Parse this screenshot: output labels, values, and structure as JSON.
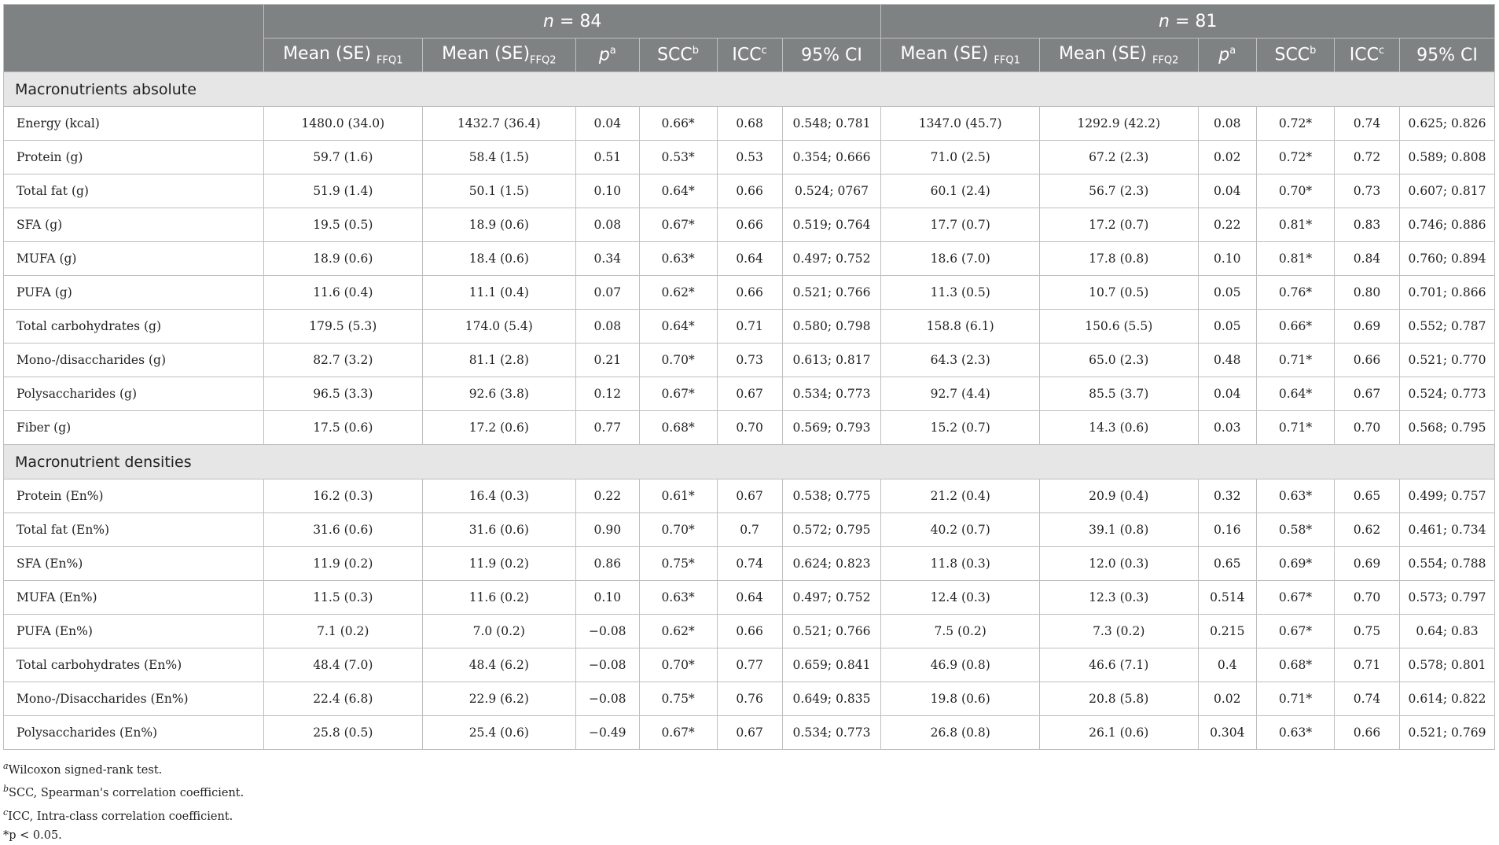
{
  "header": {
    "group1_label_n": "n",
    "group1_label_eq": " = 84",
    "group2_label_n": "n",
    "group2_label_eq": " = 81",
    "columns": [
      {
        "main": "Mean (SE) ",
        "sub": "FFQ1",
        "kind": "sub"
      },
      {
        "main": "Mean (SE)",
        "sub": "FFQ2",
        "kind": "sub"
      },
      {
        "main": "p",
        "sup": "a",
        "kind": "sup-italic"
      },
      {
        "main": "SCC",
        "sup": "b",
        "kind": "sup"
      },
      {
        "main": "ICC",
        "sup": "c",
        "kind": "sup"
      },
      {
        "main": "95% CI",
        "kind": "plain"
      },
      {
        "main": "Mean (SE) ",
        "sub": "FFQ1",
        "kind": "sub"
      },
      {
        "main": "Mean (SE) ",
        "sub": "FFQ2",
        "kind": "sub"
      },
      {
        "main": "p",
        "sup": "a",
        "kind": "sup-italic"
      },
      {
        "main": "SCC",
        "sup": "b",
        "kind": "sup"
      },
      {
        "main": "ICC",
        "sup": "c",
        "kind": "sup"
      },
      {
        "main": "95% CI",
        "kind": "plain"
      }
    ]
  },
  "sections": [
    {
      "title": "Macronutrients absolute",
      "rows": [
        {
          "label": "Energy (kcal)",
          "cells": [
            "1480.0 (34.0)",
            "1432.7 (36.4)",
            "0.04",
            "0.66*",
            "0.68",
            "0.548; 0.781",
            "1347.0 (45.7)",
            "1292.9 (42.2)",
            "0.08",
            "0.72*",
            "0.74",
            "0.625; 0.826"
          ]
        },
        {
          "label": "Protein (g)",
          "cells": [
            "59.7 (1.6)",
            "58.4 (1.5)",
            "0.51",
            "0.53*",
            "0.53",
            "0.354; 0.666",
            "71.0 (2.5)",
            "67.2 (2.3)",
            "0.02",
            "0.72*",
            "0.72",
            "0.589; 0.808"
          ]
        },
        {
          "label": "Total fat (g)",
          "cells": [
            "51.9 (1.4)",
            "50.1 (1.5)",
            "0.10",
            "0.64*",
            "0.66",
            "0.524; 0767",
            "60.1 (2.4)",
            "56.7 (2.3)",
            "0.04",
            "0.70*",
            "0.73",
            "0.607; 0.817"
          ]
        },
        {
          "label": "SFA (g)",
          "cells": [
            "19.5 (0.5)",
            "18.9 (0.6)",
            "0.08",
            "0.67*",
            "0.66",
            "0.519; 0.764",
            "17.7 (0.7)",
            "17.2 (0.7)",
            "0.22",
            "0.81*",
            "0.83",
            "0.746; 0.886"
          ]
        },
        {
          "label": "MUFA (g)",
          "cells": [
            "18.9 (0.6)",
            "18.4 (0.6)",
            "0.34",
            "0.63*",
            "0.64",
            "0.497; 0.752",
            "18.6 (7.0)",
            "17.8 (0.8)",
            "0.10",
            "0.81*",
            "0.84",
            "0.760; 0.894"
          ]
        },
        {
          "label": "PUFA (g)",
          "cells": [
            "11.6 (0.4)",
            "11.1 (0.4)",
            "0.07",
            "0.62*",
            "0.66",
            "0.521; 0.766",
            "11.3 (0.5)",
            "10.7 (0.5)",
            "0.05",
            "0.76*",
            "0.80",
            "0.701; 0.866"
          ]
        },
        {
          "label": "Total carbohydrates (g)",
          "cells": [
            "179.5 (5.3)",
            "174.0 (5.4)",
            "0.08",
            "0.64*",
            "0.71",
            "0.580; 0.798",
            "158.8 (6.1)",
            "150.6 (5.5)",
            "0.05",
            "0.66*",
            "0.69",
            "0.552; 0.787"
          ]
        },
        {
          "label": "Mono-/disaccharides (g)",
          "cells": [
            "82.7 (3.2)",
            "81.1 (2.8)",
            "0.21",
            "0.70*",
            "0.73",
            "0.613; 0.817",
            "64.3 (2.3)",
            "65.0 (2.3)",
            "0.48",
            "0.71*",
            "0.66",
            "0.521; 0.770"
          ]
        },
        {
          "label": "Polysaccharides (g)",
          "cells": [
            "96.5 (3.3)",
            "92.6 (3.8)",
            "0.12",
            "0.67*",
            "0.67",
            "0.534; 0.773",
            "92.7 (4.4)",
            "85.5 (3.7)",
            "0.04",
            "0.64*",
            "0.67",
            "0.524; 0.773"
          ]
        },
        {
          "label": "Fiber (g)",
          "cells": [
            "17.5 (0.6)",
            "17.2 (0.6)",
            "0.77",
            "0.68*",
            "0.70",
            "0.569; 0.793",
            "15.2 (0.7)",
            "14.3 (0.6)",
            "0.03",
            "0.71*",
            "0.70",
            "0.568; 0.795"
          ]
        }
      ]
    },
    {
      "title": "Macronutrient densities",
      "rows": [
        {
          "label": "Protein (En%)",
          "cells": [
            "16.2 (0.3)",
            "16.4 (0.3)",
            "0.22",
            "0.61*",
            "0.67",
            "0.538; 0.775",
            "21.2 (0.4)",
            "20.9 (0.4)",
            "0.32",
            "0.63*",
            "0.65",
            "0.499; 0.757"
          ]
        },
        {
          "label": "Total fat (En%)",
          "cells": [
            "31.6 (0.6)",
            "31.6 (0.6)",
            "0.90",
            "0.70*",
            "0.7",
            "0.572; 0.795",
            "40.2 (0.7)",
            "39.1 (0.8)",
            "0.16",
            "0.58*",
            "0.62",
            "0.461; 0.734"
          ]
        },
        {
          "label": "SFA (En%)",
          "cells": [
            "11.9 (0.2)",
            "11.9 (0.2)",
            "0.86",
            "0.75*",
            "0.74",
            "0.624; 0.823",
            "11.8 (0.3)",
            "12.0 (0.3)",
            "0.65",
            "0.69*",
            "0.69",
            "0.554; 0.788"
          ]
        },
        {
          "label": "MUFA (En%)",
          "cells": [
            "11.5 (0.3)",
            "11.6 (0.2)",
            "0.10",
            "0.63*",
            "0.64",
            "0.497; 0.752",
            "12.4 (0.3)",
            "12.3 (0.3)",
            "0.514",
            "0.67*",
            "0.70",
            "0.573; 0.797"
          ]
        },
        {
          "label": "PUFA (En%)",
          "cells": [
            "7.1 (0.2)",
            "7.0 (0.2)",
            "−0.08",
            "0.62*",
            "0.66",
            "0.521; 0.766",
            "7.5 (0.2)",
            "7.3 (0.2)",
            "0.215",
            "0.67*",
            "0.75",
            "0.64; 0.83"
          ]
        },
        {
          "label": "Total carbohydrates (En%)",
          "cells": [
            "48.4 (7.0)",
            "48.4 (6.2)",
            "−0.08",
            "0.70*",
            "0.77",
            "0.659; 0.841",
            "46.9 (0.8)",
            "46.6 (7.1)",
            "0.4",
            "0.68*",
            "0.71",
            "0.578; 0.801"
          ]
        },
        {
          "label": "Mono-/Disaccharides (En%)",
          "cells": [
            "22.4 (6.8)",
            "22.9 (6.2)",
            "−0.08",
            "0.75*",
            "0.76",
            "0.649; 0.835",
            "19.8 (0.6)",
            "20.8 (5.8)",
            "0.02",
            "0.71*",
            "0.74",
            "0.614; 0.822"
          ]
        },
        {
          "label": "Polysaccharides (En%)",
          "cells": [
            "25.8 (0.5)",
            "25.4 (0.6)",
            "−0.49",
            "0.67*",
            "0.67",
            "0.534; 0.773",
            "26.8 (0.8)",
            "26.1 (0.6)",
            "0.304",
            "0.63*",
            "0.66",
            "0.521; 0.769"
          ]
        }
      ]
    }
  ],
  "footnotes": [
    {
      "mark": "a",
      "text": "Wilcoxon signed-rank test."
    },
    {
      "mark": "b",
      "text": "SCC, Spearman's correlation coefficient."
    },
    {
      "mark": "c",
      "text": "ICC, Intra-class correlation coefficient."
    },
    {
      "mark": "",
      "text": "*p < 0.05."
    }
  ]
}
